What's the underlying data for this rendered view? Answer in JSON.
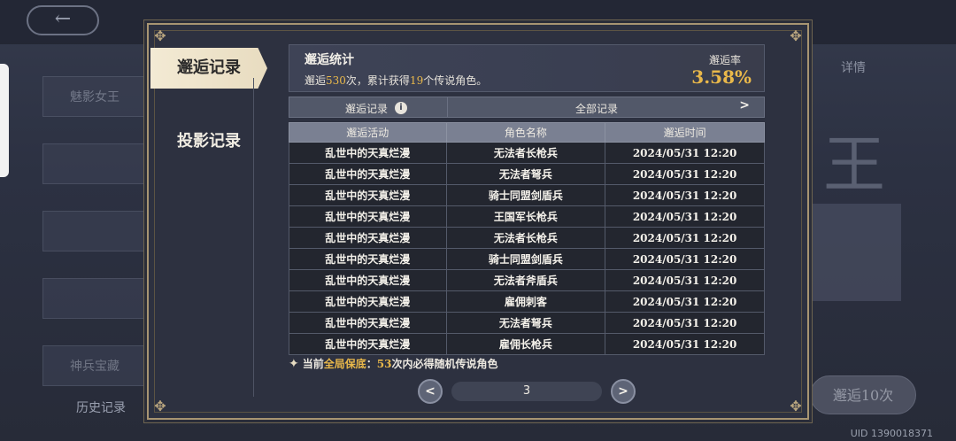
{
  "background": {
    "back_icon": "←",
    "left_cards": [
      "魅影女王",
      "",
      "",
      "",
      "神兵宝藏"
    ],
    "history_label": "历史记录",
    "big_char": "王",
    "search_label": "详情",
    "draw_button": "邂逅10次",
    "uid": "UID 1390018371"
  },
  "tabs": {
    "active": "邂逅记录",
    "inactive": "投影记录"
  },
  "stats": {
    "title": "邂逅统计",
    "line_prefix": "邂逅",
    "count": "530",
    "line_mid": "次，累计获得",
    "legend_count": "19",
    "line_suffix": "个传说角色。",
    "rate_label": "邂逅率",
    "rate_value": "3.58%"
  },
  "filter": {
    "label": "邂逅记录",
    "info_icon": "i",
    "value": "全部记录",
    "chevron": ">"
  },
  "table": {
    "headers": [
      "邂逅活动",
      "角色名称",
      "邂逅时间"
    ],
    "rows": [
      [
        "乱世中的天真烂漫",
        "无法者长枪兵",
        "2024/05/31 12:20"
      ],
      [
        "乱世中的天真烂漫",
        "无法者弩兵",
        "2024/05/31 12:20"
      ],
      [
        "乱世中的天真烂漫",
        "骑士同盟剑盾兵",
        "2024/05/31 12:20"
      ],
      [
        "乱世中的天真烂漫",
        "王国军长枪兵",
        "2024/05/31 12:20"
      ],
      [
        "乱世中的天真烂漫",
        "无法者长枪兵",
        "2024/05/31 12:20"
      ],
      [
        "乱世中的天真烂漫",
        "骑士同盟剑盾兵",
        "2024/05/31 12:20"
      ],
      [
        "乱世中的天真烂漫",
        "无法者斧盾兵",
        "2024/05/31 12:20"
      ],
      [
        "乱世中的天真烂漫",
        "雇佣刺客",
        "2024/05/31 12:20"
      ],
      [
        "乱世中的天真烂漫",
        "无法者弩兵",
        "2024/05/31 12:20"
      ],
      [
        "乱世中的天真烂漫",
        "雇佣长枪兵",
        "2024/05/31 12:20"
      ]
    ]
  },
  "pity": {
    "icon": "✦",
    "prefix": "当前",
    "highlight": "全局保底",
    "colon": "：",
    "count": "53",
    "suffix": "次内必得随机传说角色"
  },
  "pagination": {
    "prev_icon": "<",
    "page": "3",
    "next_icon": ">"
  }
}
